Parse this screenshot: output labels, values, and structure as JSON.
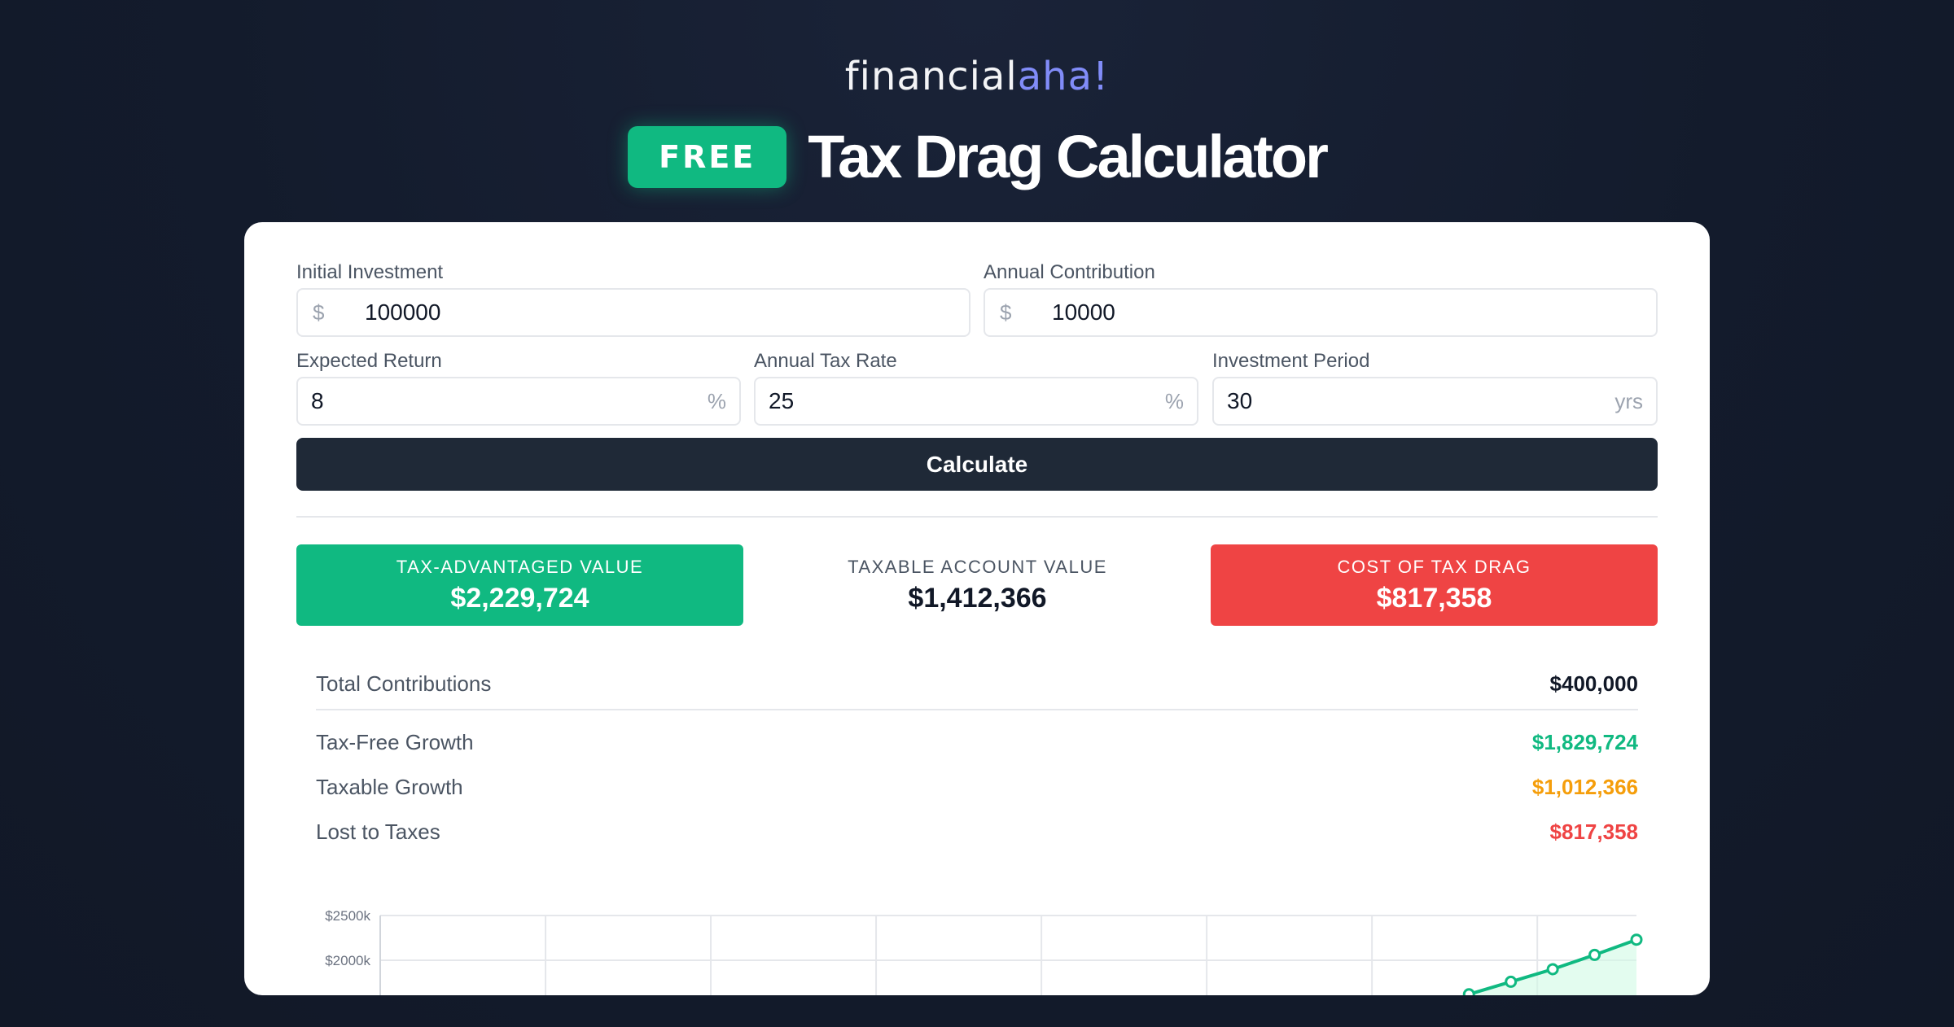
{
  "brand": {
    "name_main": "financial",
    "name_accent": "aha!"
  },
  "hero": {
    "badge": "FREE",
    "title": "Tax Drag Calculator"
  },
  "form": {
    "initial_investment": {
      "label": "Initial Investment",
      "prefix": "$",
      "value": "100000"
    },
    "annual_contribution": {
      "label": "Annual Contribution",
      "prefix": "$",
      "value": "10000"
    },
    "expected_return": {
      "label": "Expected Return",
      "value": "8",
      "suffix": "%"
    },
    "annual_tax_rate": {
      "label": "Annual Tax Rate",
      "value": "25",
      "suffix": "%"
    },
    "investment_period": {
      "label": "Investment Period",
      "value": "30",
      "suffix": "yrs"
    },
    "calculate_label": "Calculate"
  },
  "results": {
    "tax_advantaged": {
      "label": "TAX-ADVANTAGED VALUE",
      "value": "$2,229,724"
    },
    "taxable": {
      "label": "TAXABLE ACCOUNT VALUE",
      "value": "$1,412,366"
    },
    "tax_drag": {
      "label": "COST OF TAX DRAG",
      "value": "$817,358"
    }
  },
  "breakdown": {
    "total_contributions": {
      "label": "Total Contributions",
      "value": "$400,000"
    },
    "tax_free_growth": {
      "label": "Tax-Free Growth",
      "value": "$1,829,724"
    },
    "taxable_growth": {
      "label": "Taxable Growth",
      "value": "$1,012,366"
    },
    "lost_to_taxes": {
      "label": "Lost to Taxes",
      "value": "$817,358"
    }
  },
  "colors": {
    "green": "#10b981",
    "orange": "#f59e0b",
    "red": "#ef4444",
    "dark": "#1f2937",
    "accent": "#818cf8"
  },
  "chart_data": {
    "type": "line",
    "ytick_labels": [
      "$2500k",
      "$2000k"
    ],
    "ylim": [
      0,
      2500000
    ],
    "grid": true,
    "series": [
      {
        "x": [
          26,
          27,
          28,
          29,
          30
        ],
        "values": [
          1620000,
          1760000,
          1900000,
          2060000,
          2229724
        ]
      }
    ],
    "xlim": [
      0,
      30
    ]
  }
}
